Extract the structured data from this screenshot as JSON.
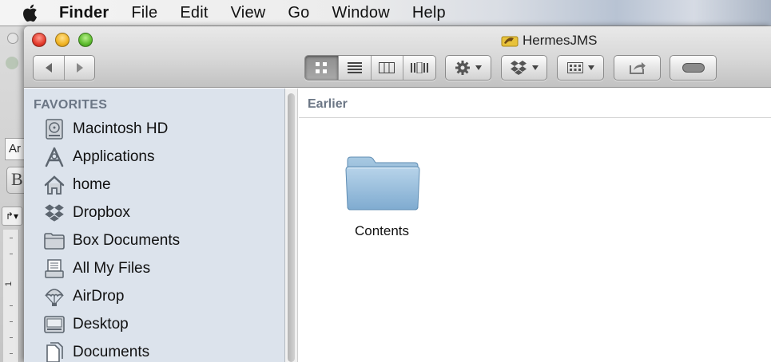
{
  "menubar": {
    "app_name": "Finder",
    "items": [
      "File",
      "Edit",
      "View",
      "Go",
      "Window",
      "Help"
    ]
  },
  "background_app": {
    "field_text": "Ar",
    "button_glyph": "B",
    "tool_glyph": "↱▾",
    "ruler_label": "1"
  },
  "window": {
    "title": "HermesJMS",
    "toolbar": {
      "back_icon": "chevron-left-icon",
      "forward_icon": "chevron-right-icon",
      "views": [
        "icon-view",
        "list-view",
        "column-view",
        "coverflow-view"
      ],
      "active_view": "icon-view",
      "buttons": [
        "action-gear-icon",
        "dropbox-icon",
        "arrange-icon",
        "share-icon",
        "tag-icon"
      ]
    }
  },
  "sidebar": {
    "section": "FAVORITES",
    "items": [
      {
        "label": "Macintosh HD",
        "icon": "hard-drive-icon"
      },
      {
        "label": "Applications",
        "icon": "applications-icon"
      },
      {
        "label": "home",
        "icon": "home-icon"
      },
      {
        "label": "Dropbox",
        "icon": "dropbox-icon"
      },
      {
        "label": "Box Documents",
        "icon": "folder-icon"
      },
      {
        "label": "All My Files",
        "icon": "all-files-icon"
      },
      {
        "label": "AirDrop",
        "icon": "airdrop-icon"
      },
      {
        "label": "Desktop",
        "icon": "desktop-icon"
      },
      {
        "label": "Documents",
        "icon": "documents-icon"
      }
    ]
  },
  "content": {
    "group_header": "Earlier",
    "files": [
      {
        "name": "Contents",
        "icon": "folder-icon"
      }
    ]
  },
  "colors": {
    "sidebar_bg": "#dce3ec",
    "section_header": "#6b7685",
    "folder_blue": "#8fb7d6"
  }
}
